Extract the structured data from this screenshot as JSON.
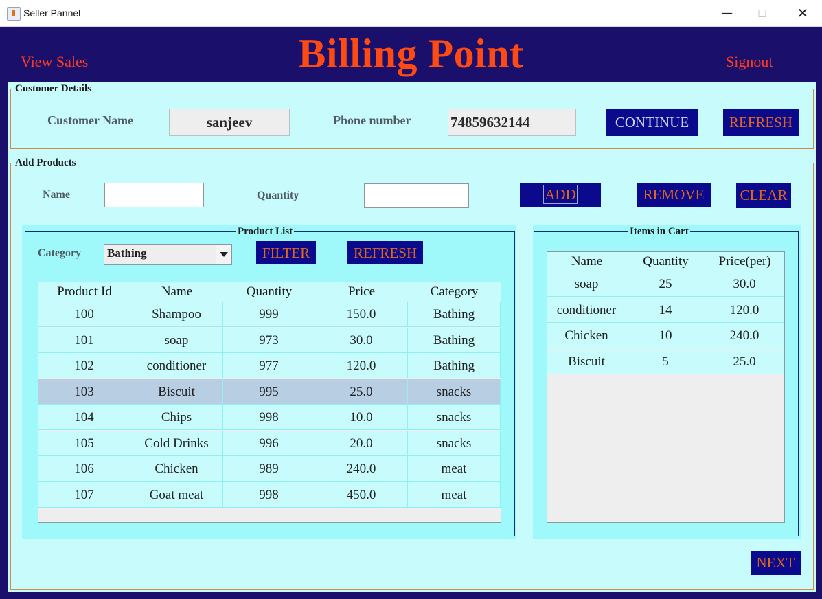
{
  "window": {
    "title": "Seller Pannel"
  },
  "header": {
    "view_sales": "View Sales",
    "title": "Billing Point",
    "signout": "Signout"
  },
  "customer_details": {
    "legend": "Customer Details",
    "name_label": "Customer Name",
    "name_value": "sanjeev",
    "phone_label": "Phone number",
    "phone_value": "74859632144",
    "continue_label": "CONTINUE",
    "refresh_label": "REFRESH"
  },
  "add_products": {
    "legend": "Add Products",
    "name_label": "Name",
    "name_value": "",
    "quantity_label": "Quantity",
    "quantity_value": "",
    "add_label": "ADD",
    "remove_label": "REMOVE",
    "clear_label": "CLEAR"
  },
  "product_list": {
    "legend": "Product List",
    "category_label": "Category",
    "category_selected": "Bathing",
    "filter_label": "FILTER",
    "refresh_label": "REFRESH",
    "columns": [
      "Product Id",
      "Name",
      "Quantity",
      "Price",
      "Category"
    ],
    "rows": [
      [
        "100",
        "Shampoo",
        "999",
        "150.0",
        "Bathing"
      ],
      [
        "101",
        "soap",
        "973",
        "30.0",
        "Bathing"
      ],
      [
        "102",
        "conditioner",
        "977",
        "120.0",
        "Bathing"
      ],
      [
        "103",
        "Biscuit",
        "995",
        "25.0",
        "snacks"
      ],
      [
        "104",
        "Chips",
        "998",
        "10.0",
        "snacks"
      ],
      [
        "105",
        "Cold Drinks",
        "996",
        "20.0",
        "snacks"
      ],
      [
        "106",
        "Chicken",
        "989",
        "240.0",
        "meat"
      ],
      [
        "107",
        "Goat meat",
        "998",
        "450.0",
        "meat"
      ]
    ],
    "selected_row": 3
  },
  "cart": {
    "legend": "Items in Cart",
    "columns": [
      "Name",
      "Quantity",
      "Price(per)"
    ],
    "rows": [
      [
        "soap",
        "25",
        "30.0"
      ],
      [
        "conditioner",
        "14",
        "120.0"
      ],
      [
        "Chicken",
        "10",
        "240.0"
      ],
      [
        "Biscuit",
        "5",
        "25.0"
      ]
    ]
  },
  "footer": {
    "next_label": "NEXT"
  },
  "colors": {
    "header_bg": "#1a0f6b",
    "accent_text": "#ff4a14",
    "button_bg": "#0c0a8c",
    "panel_bg": "#c8fcfc",
    "subpanel_bg": "#9ff8fa"
  }
}
